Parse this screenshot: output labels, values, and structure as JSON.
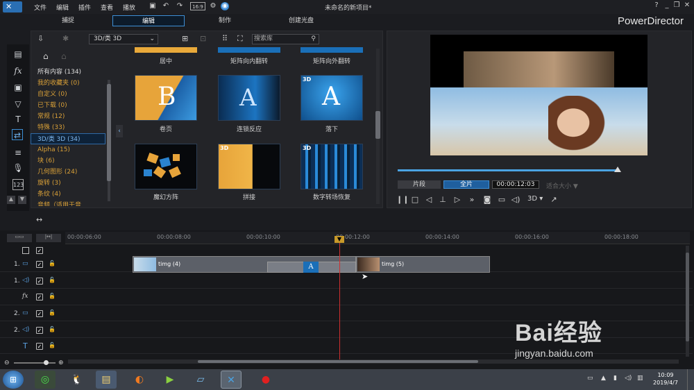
{
  "window": {
    "project_title": "未命名的新项目*",
    "brand": "PowerDirector"
  },
  "menu": [
    "文件",
    "编辑",
    "插件",
    "查看",
    "播放"
  ],
  "modes": [
    "捕捉",
    "编辑",
    "制作",
    "创建光盘"
  ],
  "library": {
    "category_select": "3D/类 3D",
    "search_placeholder": "搜索库",
    "categories": [
      "所有内容 (134)",
      "我的收藏夹 (0)",
      "自定义 (0)",
      "已下载 (0)",
      "常规 (12)",
      "特殊 (33)",
      "3D/类 3D (34)",
      "Alpha (15)",
      "块 (6)",
      "几何图形 (24)",
      "旋转 (3)",
      "条纹 (4)",
      "音频（适用于音"
    ],
    "top_labels": [
      "居中",
      "矩阵向内翻转",
      "矩阵向外翻转"
    ],
    "items": [
      {
        "label": "卷页",
        "badge": "",
        "glyph": "B"
      },
      {
        "label": "连锁反应",
        "badge": "",
        "glyph": "A"
      },
      {
        "label": "落下",
        "badge": "3D",
        "glyph": "A"
      },
      {
        "label": "魔幻方阵",
        "badge": "",
        "glyph": ""
      },
      {
        "label": "拼接",
        "badge": "3D",
        "glyph": ""
      },
      {
        "label": "数字转场恢复",
        "badge": "3D",
        "glyph": ""
      }
    ]
  },
  "preview": {
    "clip_tab": "片段",
    "full_tab": "全片",
    "timecode": "00:00:12:03",
    "fit_label": "适合大小",
    "threed_label": "3D"
  },
  "timeline": {
    "ticks": [
      "00:00:06:00",
      "00:00:08:00",
      "00:00:10:00",
      "00:00:12:00",
      "00:00:14:00",
      "00:00:16:00",
      "00:00:18:00"
    ],
    "tracks": [
      "1.",
      "1.",
      "",
      "2.",
      "2.",
      ""
    ],
    "clip1": "timg (4)",
    "clip2": "timg (5)",
    "transition": "A"
  },
  "taskbar": {
    "time": "10:09",
    "date": "2019/4/7"
  },
  "watermark": {
    "text": "Bai经验",
    "url": "jingyan.baidu.com"
  },
  "colors": {
    "accent": "#3d8fd6",
    "category": "#d9a038",
    "playhead": "#d03030"
  }
}
